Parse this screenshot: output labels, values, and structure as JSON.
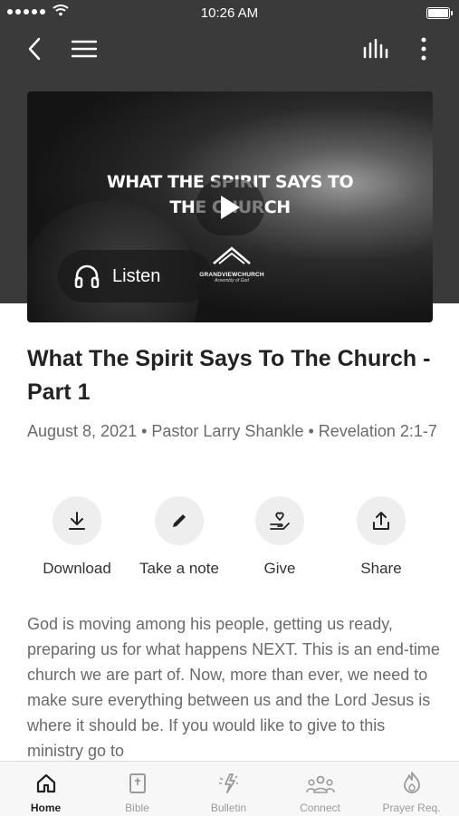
{
  "status_bar": {
    "time": "10:26 AM"
  },
  "video": {
    "overlay_line1": "WHAT THE SPIRIT SAYS TO",
    "overlay_line2": "THE CHURCH",
    "listen_label": "Listen",
    "logo_name": "GRANDVIEWCHURCH",
    "logo_tagline": "Assembly of God"
  },
  "sermon": {
    "title": "What The Spirit Says To The Church - Part 1",
    "meta": "August 8, 2021 • Pastor Larry Shankle • Revelation 2:1-7",
    "description": "God is moving among his people, getting us ready, preparing us for what happens NEXT. This is an end-time church we are part of. Now, more than ever, we need to make sure everything between us and the Lord Jesus is where it should be. If you would like to give to this ministry go to"
  },
  "actions": [
    {
      "label": "Download",
      "icon": "download-icon"
    },
    {
      "label": "Take a note",
      "icon": "pencil-icon"
    },
    {
      "label": "Give",
      "icon": "give-hand-icon"
    },
    {
      "label": "Share",
      "icon": "share-icon"
    }
  ],
  "tabs": [
    {
      "label": "Home",
      "icon": "home-icon",
      "active": true
    },
    {
      "label": "Bible",
      "icon": "bible-icon",
      "active": false
    },
    {
      "label": "Bulletin",
      "icon": "bulletin-icon",
      "active": false
    },
    {
      "label": "Connect",
      "icon": "connect-icon",
      "active": false
    },
    {
      "label": "Prayer Req.",
      "icon": "flame-icon",
      "active": false
    }
  ],
  "colors": {
    "header_bg": "#3a3a3a",
    "text_dark": "#222222",
    "text_muted": "#6a6a6a",
    "tab_bg": "#f7f7f7"
  }
}
